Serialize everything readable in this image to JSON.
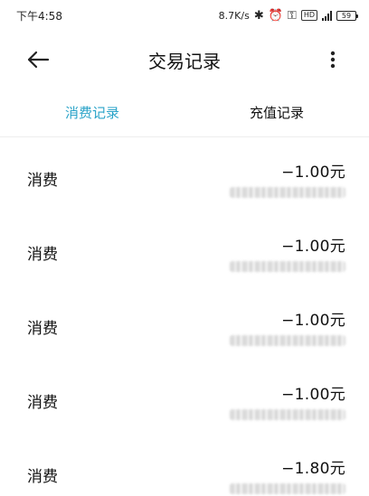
{
  "status_bar": {
    "time": "下午4:58",
    "network_speed": "8.7K/s",
    "hd_label": "HD",
    "battery_level": "59",
    "icons": [
      "bluetooth-icon",
      "alarm-icon",
      "key-icon",
      "hd-icon",
      "signal-icon",
      "battery-icon"
    ]
  },
  "app_bar": {
    "title": "交易记录",
    "back_icon": "arrow-left-icon",
    "more_icon": "more-vertical-icon"
  },
  "tabs": [
    {
      "label": "消费记录",
      "active": true
    },
    {
      "label": "充值记录",
      "active": false
    }
  ],
  "colors": {
    "accent": "#2aa3c8",
    "text": "#111111",
    "divider": "#eeeeee"
  },
  "records": [
    {
      "label": "消费",
      "amount": "−1.00元"
    },
    {
      "label": "消费",
      "amount": "−1.00元"
    },
    {
      "label": "消费",
      "amount": "−1.00元"
    },
    {
      "label": "消费",
      "amount": "−1.00元"
    },
    {
      "label": "消费",
      "amount": "−1.80元"
    }
  ]
}
